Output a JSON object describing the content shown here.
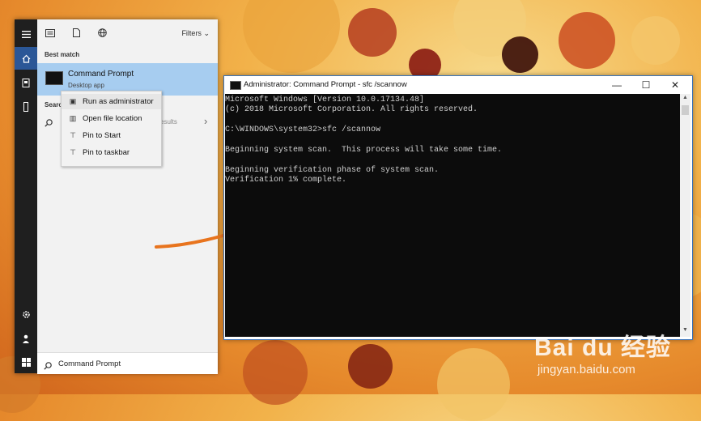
{
  "colors": {
    "accent": "#2b5797",
    "selected": "#a7cdf0",
    "console_bg": "#0c0c0c",
    "console_fg": "#cfcfcf",
    "arrow": "#e8741e"
  },
  "start_menu": {
    "filters_label": "Filters",
    "best_match_header": "Best match",
    "best_match": {
      "title": "Command Prompt",
      "subtitle": "Desktop app"
    },
    "search_header": "Searc",
    "search_result_fragment": "esults",
    "context_menu": [
      {
        "label": "Run as administrator",
        "icon": "shield-admin-icon"
      },
      {
        "label": "Open file location",
        "icon": "file-location-icon"
      },
      {
        "label": "Pin to Start",
        "icon": "pin-icon"
      },
      {
        "label": "Pin to taskbar",
        "icon": "pin-icon"
      }
    ],
    "search_box_text": "Command Prompt"
  },
  "cmd_window": {
    "title": "Administrator: Command Prompt - sfc /scannow",
    "lines": [
      "Microsoft Windows [Version 10.0.17134.48]",
      "(c) 2018 Microsoft Corporation. All rights reserved.",
      "",
      "C:\\WINDOWS\\system32>sfc /scannow",
      "",
      "Beginning system scan.  This process will take some time.",
      "",
      "Beginning verification phase of system scan.",
      "Verification 1% complete."
    ]
  },
  "watermark": {
    "logo": "Bai du 经验",
    "url": "jingyan.baidu.com"
  }
}
